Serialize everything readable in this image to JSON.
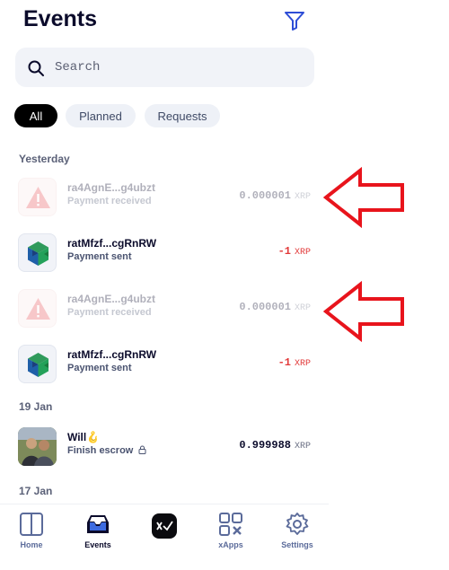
{
  "header": {
    "title": "Events"
  },
  "search": {
    "placeholder": "Search"
  },
  "tabs": [
    {
      "label": "All",
      "active": true
    },
    {
      "label": "Planned",
      "active": false
    },
    {
      "label": "Requests",
      "active": false
    }
  ],
  "sections": [
    {
      "label": "Yesterday",
      "items": [
        {
          "name": "ra4AgnE...g4ubzt",
          "subtitle": "Payment received",
          "amount": "0.000001",
          "currency": "XRP",
          "icon": "warning-icon",
          "faded": true
        },
        {
          "name": "ratMfzf...cgRnRW",
          "subtitle": "Payment sent",
          "amount": "-1",
          "currency": "XRP",
          "icon": "cube-icon",
          "faded": false
        },
        {
          "name": "ra4AgnE...g4ubzt",
          "subtitle": "Payment received",
          "amount": "0.000001",
          "currency": "XRP",
          "icon": "warning-icon",
          "faded": true
        },
        {
          "name": "ratMfzf...cgRnRW",
          "subtitle": "Payment sent",
          "amount": "-1",
          "currency": "XRP",
          "icon": "cube-icon",
          "faded": false
        }
      ]
    },
    {
      "label": "19 Jan",
      "items": [
        {
          "name": "Will",
          "name_emoji": "🪝",
          "subtitle": "Finish escrow",
          "amount": "0.999988",
          "currency": "XRP",
          "icon": "user-photo",
          "faded": false
        }
      ]
    },
    {
      "label": "17 Jan",
      "items": []
    }
  ],
  "bottom_nav": [
    {
      "label": "Home",
      "icon": "home-icon",
      "active": false
    },
    {
      "label": "Events",
      "icon": "inbox-icon",
      "active": true
    },
    {
      "label": "",
      "icon": "xumm-logo-icon",
      "active": false
    },
    {
      "label": "xApps",
      "icon": "xapps-icon",
      "active": false
    },
    {
      "label": "Settings",
      "icon": "gear-icon",
      "active": false
    }
  ],
  "colors": {
    "annotation_arrow": "#e8141c",
    "negative_amount": "#e23a3a",
    "tab_active_bg": "#000000"
  }
}
